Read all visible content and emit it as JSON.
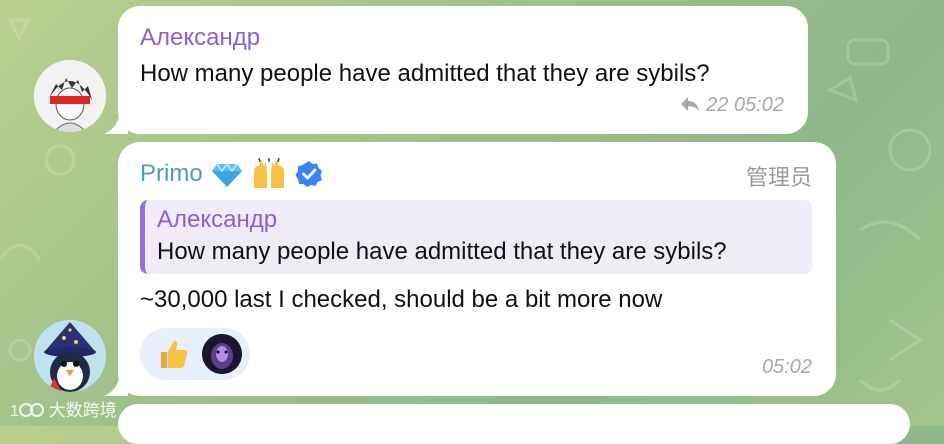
{
  "messages": [
    {
      "sender": "Александр",
      "text": "How many people have admitted that they are sybils?",
      "forwards": "22",
      "time": "05:02",
      "sender_color": "#8e5fd1"
    },
    {
      "sender": "Primo",
      "badges": [
        "diamond-emoji",
        "raising-hands-emoji",
        "verified-icon"
      ],
      "role": "管理员",
      "reply": {
        "sender": "Александр",
        "text": "How many people have admitted that they are sybils?"
      },
      "text": "~30,000 last I checked, should be a bit more now",
      "reactions": [
        "thumbs-up-emoji",
        "avatar-reaction"
      ],
      "time": "05:02",
      "sender_color": "#4f9bbd"
    }
  ],
  "watermark": "大数跨境",
  "colors": {
    "background": "#a8c68c",
    "bubble": "#ffffff",
    "reply_bg": "#f0ebf8",
    "reply_bar": "#9a6fd3",
    "reaction_bg": "#e7effa",
    "verified": "#3b82f6"
  }
}
